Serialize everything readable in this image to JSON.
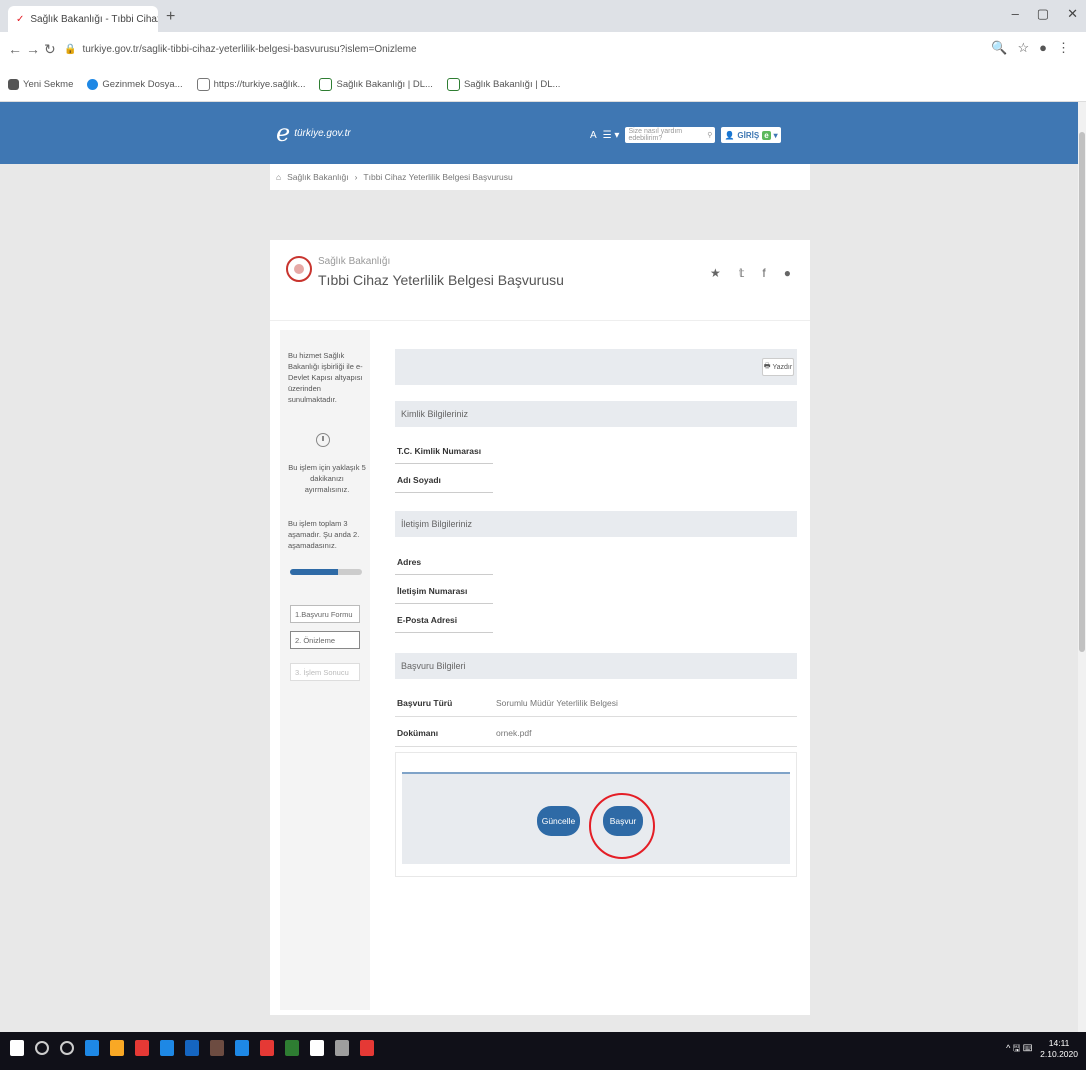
{
  "browser": {
    "tab_title": "Sağlık Bakanlığı - Tıbbi Cihaz Ye ×",
    "new_tab": "+",
    "window_controls": [
      "–",
      "▢",
      "✕"
    ],
    "url": "turkiye.gov.tr/saglik-tibbi-cihaz-yeterlilik-belgesi-basvurusu?islem=Onizleme",
    "bookmarks": [
      {
        "label": "Yeni Sekme",
        "color": "#555555"
      },
      {
        "label": "Gezinmek Dosya...",
        "color": "#1e88e5"
      },
      {
        "label": "https://turkiye.sağlık...",
        "color": "#777777"
      },
      {
        "label": "Sağlık Bakanlığı | DL...",
        "color": "#2e7d32"
      },
      {
        "label": "Sağlık Bakanlığı | DL...",
        "color": "#2e7d32"
      }
    ]
  },
  "header": {
    "logo_text": "türkiye.gov.tr",
    "font_size_label": "A",
    "menu_label": "☰ ▾",
    "search_placeholder": "Size nasıl yardım edebilirim?",
    "login_label": "GİRİŞ",
    "login_badge": "e"
  },
  "breadcrumb": {
    "items": [
      "Sağlık Bakanlığı",
      "Tıbbi Cihaz Yeterlilik Belgesi Başvurusu"
    ]
  },
  "service": {
    "institution": "Sağlık Bakanlığı",
    "title": "Tıbbi Cihaz Yeterlilik Belgesi Başvurusu",
    "social": [
      "★",
      "𝕥",
      "f",
      "●"
    ]
  },
  "sidebar": {
    "notice": "Bu hizmet Sağlık Bakanlığı işbirliği ile e-Devlet Kapısı altyapısı üzerinden sunulmaktadır.",
    "duration": "Bu işlem için yaklaşık 5 dakikanızı ayırmalısınız.",
    "progress_text": "Bu işlem toplam 3 aşamadır. Şu anda 2. aşamadasınız.",
    "progress_fraction": 0.67,
    "steps": [
      "1.Başvuru Formu",
      "2. Önizleme",
      "3. İşlem Sonucu"
    ]
  },
  "main": {
    "print_label": "Yazdır",
    "sections": {
      "identity": "Kimlik Bilgileriniz",
      "contact": "İletişim Bilgileriniz",
      "application": "Başvuru Bilgileri"
    },
    "fields": {
      "tc_label": "T.C. Kimlik Numarası",
      "tc_value": "",
      "name_label": "Adı Soyadı",
      "name_value": "",
      "address_label": "Adres",
      "address_value": "",
      "phone_label": "İletişim Numarası",
      "phone_value": "",
      "email_label": "E-Posta Adresi",
      "email_value": "",
      "type_label": "Başvuru Türü",
      "type_value": "Sorumlu Müdür Yeterlilik Belgesi",
      "doc_label": "Dokümanı",
      "doc_value": "ornek.pdf"
    },
    "buttons": {
      "update": "Güncelle",
      "submit": "Başvur"
    }
  },
  "taskbar": {
    "tray": "^ 🖫 ⌨",
    "time": "14:11",
    "date": "2.10.2020",
    "icon_colors": [
      "#ffffff",
      "#cccccc",
      "#cccccc",
      "#1e88e5",
      "#f9a825",
      "#e53935",
      "#1e88e5",
      "#1565c0",
      "#6d4c41",
      "#1e88e5",
      "#e53935",
      "#2e7d32",
      "#ffffff",
      "#9e9e9e",
      "#e53935"
    ]
  },
  "colors": {
    "brand_blue": "#3f77b3",
    "button_blue": "#2e6aa6",
    "highlight_red": "#e41e26"
  }
}
